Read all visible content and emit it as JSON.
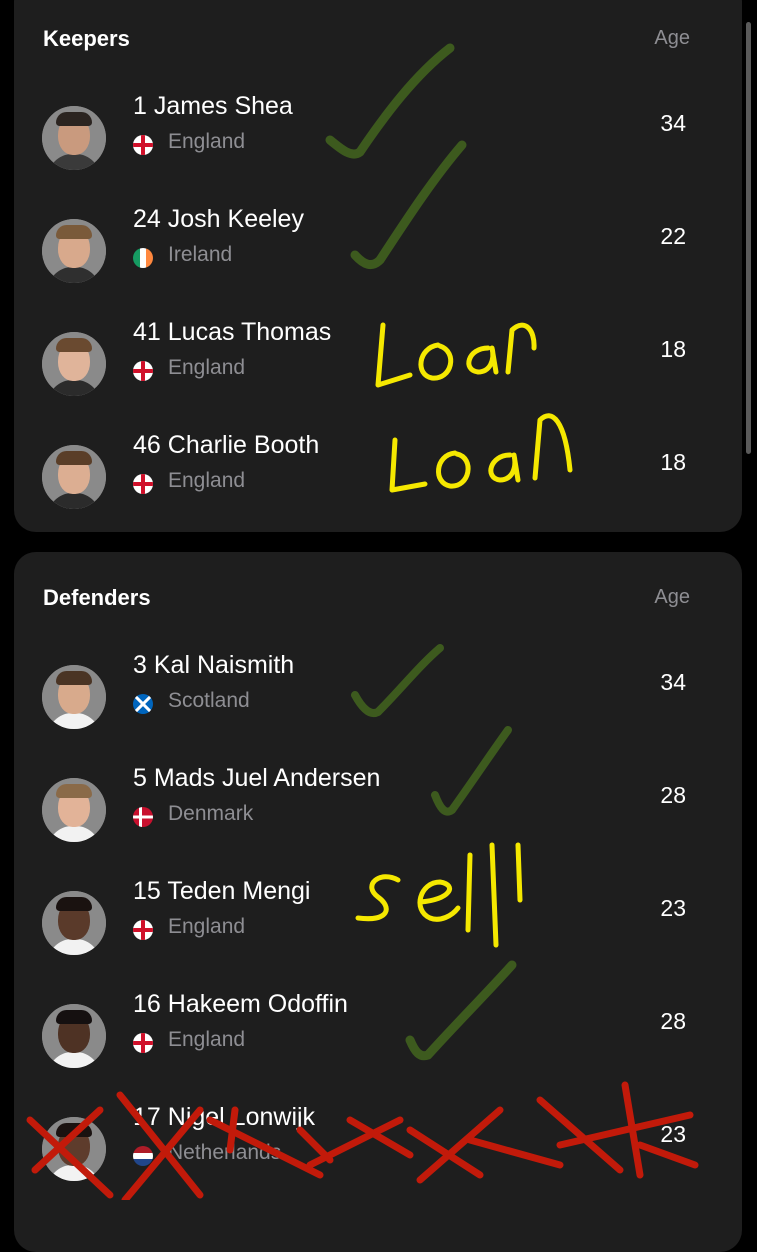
{
  "sections": [
    {
      "title": "Keepers",
      "age_header": "Age",
      "players": [
        {
          "number": "1",
          "name": "James Shea",
          "country": "England",
          "age": "34",
          "flag": "england",
          "skin": "#c99a7e",
          "hair": "#2b2420",
          "shirt": "#3a3a3a"
        },
        {
          "number": "24",
          "name": "Josh Keeley",
          "country": "Ireland",
          "age": "22",
          "flag": "ireland",
          "skin": "#d8a98c",
          "hair": "#7a5a3a",
          "shirt": "#2f2f2f"
        },
        {
          "number": "41",
          "name": "Lucas Thomas",
          "country": "England",
          "age": "18",
          "flag": "england",
          "skin": "#e0b49a",
          "hair": "#6a4a30",
          "shirt": "#2b2b2b"
        },
        {
          "number": "46",
          "name": "Charlie Booth",
          "country": "England",
          "age": "18",
          "flag": "england",
          "skin": "#dcae92",
          "hair": "#5a3e28",
          "shirt": "#2b2b2b"
        }
      ]
    },
    {
      "title": "Defenders",
      "age_header": "Age",
      "players": [
        {
          "number": "3",
          "name": "Kal Naismith",
          "country": "Scotland",
          "age": "34",
          "flag": "scotland",
          "skin": "#d8aa8c",
          "hair": "#4a3424",
          "shirt": "#f2f2f2"
        },
        {
          "number": "5",
          "name": "Mads Juel Andersen",
          "country": "Denmark",
          "age": "28",
          "flag": "denmark",
          "skin": "#e2b398",
          "hair": "#8a6a48",
          "shirt": "#f2f2f2"
        },
        {
          "number": "15",
          "name": "Teden Mengi",
          "country": "England",
          "age": "23",
          "flag": "england",
          "skin": "#5a3a2a",
          "hair": "#1a1210",
          "shirt": "#f2f2f2"
        },
        {
          "number": "16",
          "name": "Hakeem Odoffin",
          "country": "England",
          "age": "28",
          "flag": "england",
          "skin": "#4e3224",
          "hair": "#151010",
          "shirt": "#f2f2f2"
        },
        {
          "number": "17",
          "name": "Nigel Lonwijk",
          "country": "Netherlands",
          "age": "23",
          "flag": "netherlands",
          "skin": "#5e3c2c",
          "hair": "#1a1210",
          "shirt": "#f2f2f2"
        }
      ]
    }
  ],
  "annotations": {
    "lucas_thomas": "Loan",
    "charlie_booth": "Loan",
    "teden_mengi": "sell"
  },
  "colors": {
    "background": "#000000",
    "card": "#1e1e1e",
    "muted_text": "#8e8e93",
    "check_ink": "#3d5a1e",
    "yellow_ink": "#f5e800",
    "red_ink": "#c21a0a"
  }
}
